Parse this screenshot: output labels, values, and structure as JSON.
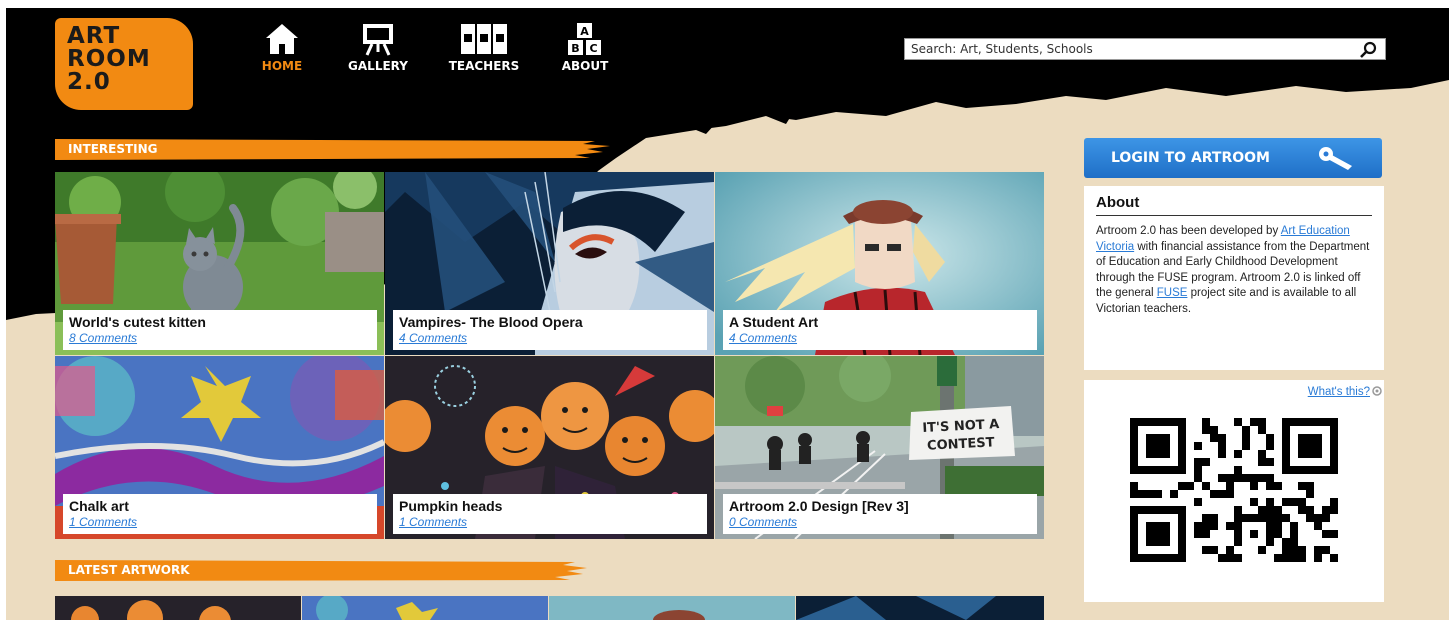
{
  "logo": {
    "line1": "ART",
    "line2": "ROOM",
    "line3": "2.0"
  },
  "nav": [
    {
      "label": "HOME",
      "icon": "home-icon",
      "active": true
    },
    {
      "label": "GALLERY",
      "icon": "easel-icon",
      "active": false
    },
    {
      "label": "TEACHERS",
      "icon": "books-icon",
      "active": false
    },
    {
      "label": "ABOUT",
      "icon": "abc-blocks-icon",
      "active": false
    }
  ],
  "search": {
    "placeholder": "Search: Art, Students, Schools"
  },
  "sections": {
    "interesting": "INTERESTING",
    "latest": "LATEST ARTWORK"
  },
  "interesting_items": [
    {
      "title": "World's cutest kitten",
      "comments": "8 Comments"
    },
    {
      "title": "Vampires- The Blood Opera",
      "comments": "4 Comments"
    },
    {
      "title": "A Student Art",
      "comments": "4 Comments"
    },
    {
      "title": "Chalk art",
      "comments": "1 Comments"
    },
    {
      "title": "Pumpkin heads",
      "comments": "1 Comments"
    },
    {
      "title": "Artroom 2.0 Design [Rev 3]",
      "comments": "0 Comments"
    }
  ],
  "photo_sign": {
    "line1": "IT'S NOT A",
    "line2": "CONTEST"
  },
  "sidebar": {
    "login_label": "LOGIN TO ARTROOM",
    "about_title": "About",
    "about_p1": "Artroom 2.0 has been developed by ",
    "about_link1": "Art Education Victoria",
    "about_p2": " with financial assistance from the Department of Education and Early Childhood Development through the FUSE program. Artroom 2.0 is linked off the general ",
    "about_link2": "FUSE",
    "about_p3": " project site and is available to all Victorian teachers.",
    "whats_this": "What's this?"
  },
  "colors": {
    "accent_orange": "#f28a12",
    "login_blue": "#2a7bd6",
    "background_cream": "#ecdcc0",
    "header_black": "#000000",
    "link_blue": "#2a7bd6"
  }
}
